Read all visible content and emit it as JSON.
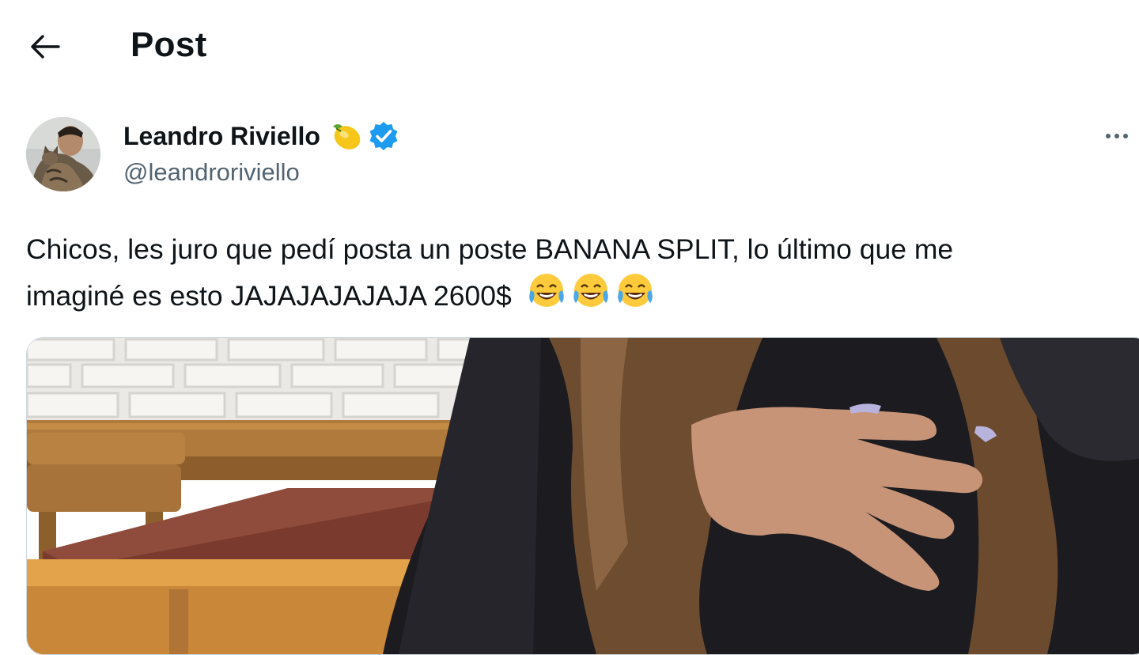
{
  "header": {
    "back_icon": "arrow-left-icon",
    "title": "Post"
  },
  "tweet": {
    "author": {
      "name": "Leandro Riviello",
      "name_emoji": "lemon",
      "verified": true,
      "verified_color": "#1d9bf0",
      "handle": "@leandroriviello"
    },
    "more_icon": "more-horizontal-icon",
    "text_line1": "Chicos, les juro que pedí posta un poste BANANA SPLIT, lo último que me",
    "text_line2": "imaginé es esto JAJAJAJAJAJA 2600$",
    "text_emojis": [
      "face-with-tears-of-joy",
      "face-with-tears-of-joy",
      "face-with-tears-of-joy"
    ],
    "media_type": "photo"
  },
  "colors": {
    "text_primary": "#0f1419",
    "text_secondary": "#536471",
    "verified_blue": "#1d9bf0"
  }
}
